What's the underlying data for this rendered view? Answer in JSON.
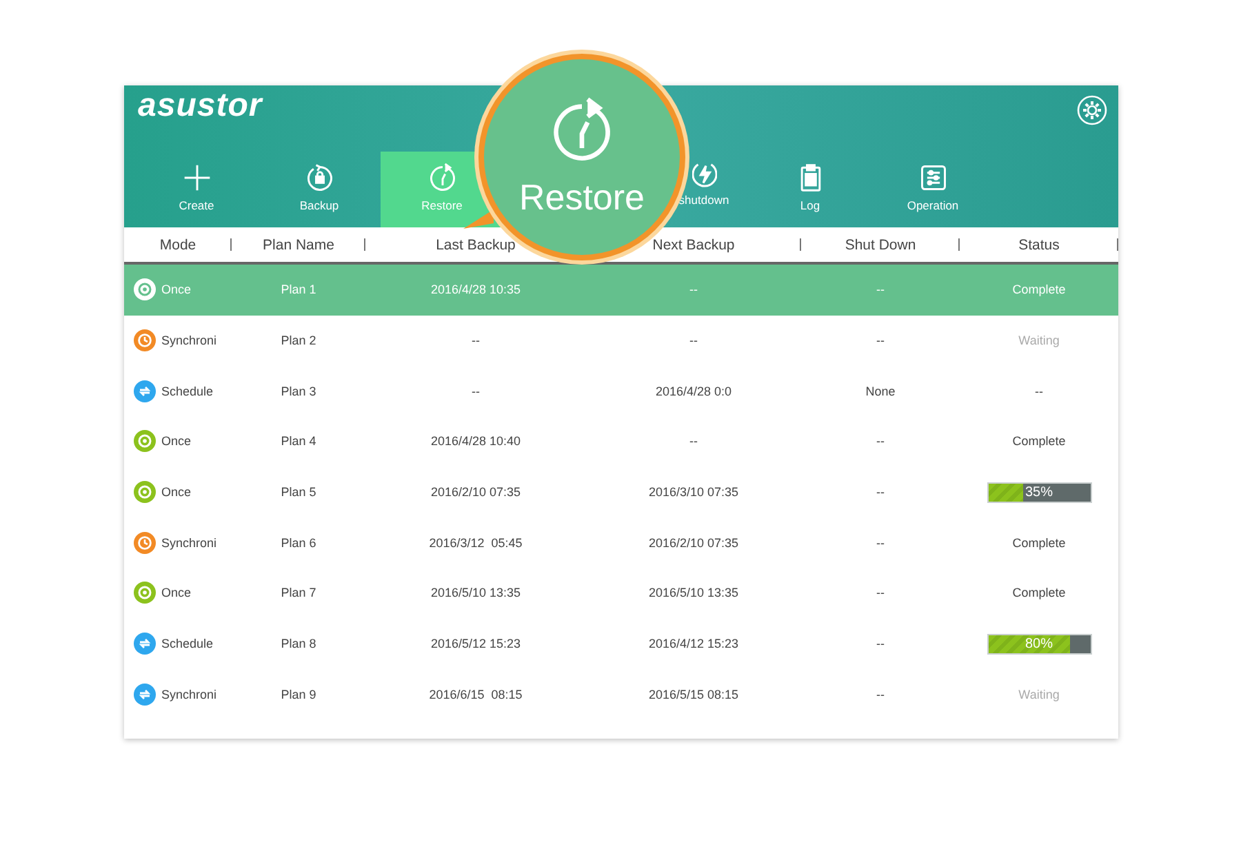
{
  "app": {
    "logo": "asustor"
  },
  "toolbar": [
    {
      "label": "Create",
      "selected": false
    },
    {
      "label": "Backup",
      "selected": false
    },
    {
      "label": "Restore",
      "selected": true
    },
    {
      "label": "shutdown",
      "selected": false
    },
    {
      "label": "Log",
      "selected": false
    },
    {
      "label": "Operation",
      "selected": false
    }
  ],
  "callout": {
    "label": "Restore"
  },
  "table": {
    "columns": [
      "Mode",
      "Plan Name",
      "Last Backup",
      "Next Backup",
      "Shut Down",
      "Status"
    ],
    "rows": [
      {
        "mode": "Once",
        "kind": "once",
        "plan": "Plan 1",
        "last": "2016/4/28 10:35",
        "next": "--",
        "shutdown": "--",
        "status": {
          "kind": "text",
          "text": "Complete",
          "dim": false
        },
        "selected": true
      },
      {
        "mode": "Synchroni",
        "kind": "sync",
        "plan": "Plan 2",
        "last": "--",
        "next": "--",
        "shutdown": "--",
        "status": {
          "kind": "text",
          "text": "Waiting",
          "dim": true
        },
        "selected": false
      },
      {
        "mode": "Schedule",
        "kind": "schedule",
        "plan": "Plan 3",
        "last": "--",
        "next": "2016/4/28 0:0",
        "shutdown": "None",
        "status": {
          "kind": "text",
          "text": "--",
          "dim": false
        },
        "selected": false
      },
      {
        "mode": "Once",
        "kind": "once",
        "plan": "Plan 4",
        "last": "2016/4/28 10:40",
        "next": "--",
        "shutdown": "--",
        "status": {
          "kind": "text",
          "text": "Complete",
          "dim": false
        },
        "selected": false
      },
      {
        "mode": "Once",
        "kind": "once",
        "plan": "Plan 5",
        "last": "2016/2/10 07:35",
        "next": "2016/3/10 07:35",
        "shutdown": "--",
        "status": {
          "kind": "progress",
          "level": 0.35,
          "text": "35%"
        },
        "selected": false
      },
      {
        "mode": "Synchroni",
        "kind": "sync",
        "plan": "Plan 6",
        "last": "2016/3/12  05:45",
        "next": "2016/2/10 07:35",
        "shutdown": "--",
        "status": {
          "kind": "text",
          "text": "Complete",
          "dim": false
        },
        "selected": false
      },
      {
        "mode": "Once",
        "kind": "once",
        "plan": "Plan 7",
        "last": "2016/5/10 13:35",
        "next": "2016/5/10 13:35",
        "shutdown": "--",
        "status": {
          "kind": "text",
          "text": "Complete",
          "dim": false
        },
        "selected": false
      },
      {
        "mode": "Schedule",
        "kind": "schedule",
        "plan": "Plan 8",
        "last": "2016/5/12 15:23",
        "next": "2016/4/12 15:23",
        "shutdown": "--",
        "status": {
          "kind": "progress",
          "level": 0.8,
          "text": "80%"
        },
        "selected": false
      },
      {
        "mode": "Synchroni",
        "kind": "schedule",
        "plan": "Plan 9",
        "last": "2016/6/15  08:15",
        "next": "2016/5/15 08:15",
        "shutdown": "--",
        "status": {
          "kind": "text",
          "text": "Waiting",
          "dim": true
        },
        "selected": false
      }
    ]
  }
}
